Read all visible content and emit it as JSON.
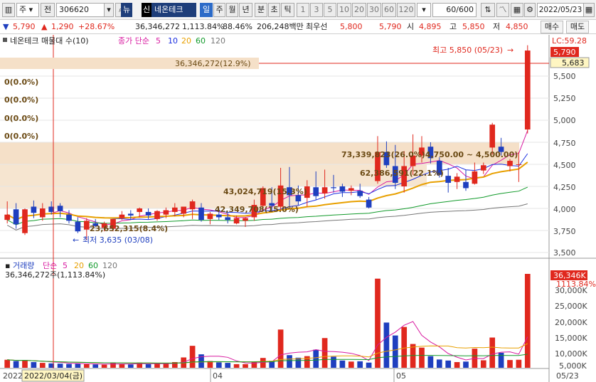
{
  "toolbar": {
    "btn1": "주",
    "btn2": "전",
    "code": "306620",
    "new_badge": "뉴",
    "credit_badge": "신",
    "name": "네온테크",
    "periods": [
      "일",
      "주",
      "월",
      "년",
      "분",
      "초",
      "틱"
    ],
    "period_active": "일",
    "minutes": [
      "1",
      "3",
      "5",
      "10",
      "20",
      "30",
      "60",
      "120"
    ],
    "count": "60/600",
    "date": "2022/05/23"
  },
  "info": {
    "price": "5,790",
    "change": "1,290",
    "change_pct": "+28.67%",
    "volume": "36,346,272",
    "volume_pct": "1,113.84%",
    "rate": "88.46%",
    "amount": "206,248백만",
    "priority_label": "최우선",
    "ask": "5,800",
    "bid": "5,790",
    "open_label": "시",
    "open": "4,895",
    "high_label": "고",
    "high": "5,850",
    "low_label": "저",
    "low": "4,850",
    "buy_label": "매수",
    "sell_label": "매도"
  },
  "price_panel": {
    "legend_name": "네온테크 매물대 수(10)",
    "ma_label": "종가 단순",
    "ma_periods": [
      "5",
      "10",
      "20",
      "60",
      "120"
    ],
    "lc_label": "LC:59.28",
    "current_price_tag": "5,790",
    "hover_price_tag": "5,683",
    "high_note": "최고 5,850 (05/23)",
    "low_note": "최저 3,635 (03/08)",
    "zero_labels": [
      "0(0.0%)",
      "0(0.0%)",
      "0(0.0%)",
      "0(0.0%)"
    ],
    "profile_labels": [
      "36,346,272(12.9%)",
      "73,339,823(26.0%)4,750.00 ~ 4,500.00)",
      "62,386,591(22.1%)",
      "43,024,719(15.3%)",
      "42,349,708(15.0%)",
      "23,652,315(8.4%)"
    ],
    "y_ticks": [
      "5,500",
      "5,250",
      "5,000",
      "4,750",
      "4,500",
      "4,250",
      "4,000",
      "3,750",
      "3,500"
    ]
  },
  "volume_panel": {
    "title": "거래량",
    "ma_label": "단순",
    "ma_periods": [
      "5",
      "20",
      "60",
      "120"
    ],
    "last_volume": "36,346,272주(1,113.84%)",
    "tag_volume": "36,346K",
    "tag_pct": "1113.84%",
    "y_ticks": [
      "30,000K",
      "25,000K",
      "20,000K",
      "15,000K",
      "10,000K",
      "5,000K"
    ]
  },
  "x_axis": {
    "labels": [
      "2022",
      "04",
      "05",
      "05/23"
    ],
    "crosshair_date": "2022/03/04(금)"
  },
  "colors": {
    "up": "#e0281e",
    "down": "#1f3fbf",
    "ma5": "#d81aa0",
    "ma10": "#1a2ee0",
    "ma20": "#e8a000",
    "ma60": "#119a2a",
    "ma120": "#777777",
    "profile": "#f5e0c8"
  },
  "chart_data": {
    "type": "candlestick",
    "price_range": [
      3450,
      5800
    ],
    "volume_range_k": [
      0,
      36346
    ],
    "candles": [
      {
        "o": 3870,
        "h": 4080,
        "l": 3830,
        "c": 3930,
        "v": 3100
      },
      {
        "o": 3990,
        "h": 4060,
        "l": 3770,
        "c": 3820,
        "v": 2600
      },
      {
        "o": 3720,
        "h": 4000,
        "l": 3700,
        "c": 3990,
        "v": 3000
      },
      {
        "o": 4020,
        "h": 4090,
        "l": 3890,
        "c": 3950,
        "v": 2200
      },
      {
        "o": 3900,
        "h": 4060,
        "l": 3860,
        "c": 4000,
        "v": 1900
      },
      {
        "o": 4020,
        "h": 4080,
        "l": 3930,
        "c": 3960,
        "v": 1700
      },
      {
        "o": 4030,
        "h": 4060,
        "l": 3900,
        "c": 3970,
        "v": 1600
      },
      {
        "o": 3930,
        "h": 3980,
        "l": 3830,
        "c": 3860,
        "v": 1500
      },
      {
        "o": 3850,
        "h": 3900,
        "l": 3720,
        "c": 3740,
        "v": 1600
      },
      {
        "o": 3760,
        "h": 3890,
        "l": 3640,
        "c": 3860,
        "v": 1400
      },
      {
        "o": 3830,
        "h": 3880,
        "l": 3790,
        "c": 3800,
        "v": 1300
      },
      {
        "o": 3780,
        "h": 3850,
        "l": 3740,
        "c": 3830,
        "v": 1200
      },
      {
        "o": 3770,
        "h": 3870,
        "l": 3740,
        "c": 3880,
        "v": 1900
      },
      {
        "o": 3890,
        "h": 3970,
        "l": 3870,
        "c": 3930,
        "v": 1500
      },
      {
        "o": 3940,
        "h": 3980,
        "l": 3870,
        "c": 3920,
        "v": 1300
      },
      {
        "o": 3960,
        "h": 4010,
        "l": 3900,
        "c": 4000,
        "v": 2000
      },
      {
        "o": 3960,
        "h": 4000,
        "l": 3880,
        "c": 3920,
        "v": 1400
      },
      {
        "o": 3880,
        "h": 3980,
        "l": 3860,
        "c": 3970,
        "v": 1600
      },
      {
        "o": 3930,
        "h": 4010,
        "l": 3890,
        "c": 3980,
        "v": 1500
      },
      {
        "o": 3960,
        "h": 4060,
        "l": 3910,
        "c": 4010,
        "v": 2200
      },
      {
        "o": 3940,
        "h": 4010,
        "l": 3900,
        "c": 4020,
        "v": 4000
      },
      {
        "o": 3990,
        "h": 4100,
        "l": 3880,
        "c": 4080,
        "v": 8500
      },
      {
        "o": 4010,
        "h": 4060,
        "l": 3850,
        "c": 3870,
        "v": 5200
      },
      {
        "o": 3880,
        "h": 3960,
        "l": 3820,
        "c": 3940,
        "v": 2600
      },
      {
        "o": 3930,
        "h": 4000,
        "l": 3870,
        "c": 3900,
        "v": 2100
      },
      {
        "o": 3900,
        "h": 3960,
        "l": 3830,
        "c": 3870,
        "v": 1900
      },
      {
        "o": 3830,
        "h": 3920,
        "l": 3820,
        "c": 3890,
        "v": 1400
      },
      {
        "o": 3860,
        "h": 3900,
        "l": 3790,
        "c": 3890,
        "v": 1400
      },
      {
        "o": 3900,
        "h": 4100,
        "l": 3860,
        "c": 4040,
        "v": 2200
      },
      {
        "o": 4030,
        "h": 4250,
        "l": 3970,
        "c": 4230,
        "v": 3800
      },
      {
        "o": 4060,
        "h": 4240,
        "l": 3980,
        "c": 4030,
        "v": 2700
      },
      {
        "o": 4020,
        "h": 4460,
        "l": 3980,
        "c": 4260,
        "v": 14800
      },
      {
        "o": 4240,
        "h": 4470,
        "l": 4020,
        "c": 4150,
        "v": 4900
      },
      {
        "o": 4150,
        "h": 4260,
        "l": 4040,
        "c": 4080,
        "v": 3900
      },
      {
        "o": 4120,
        "h": 4320,
        "l": 4020,
        "c": 4250,
        "v": 4500
      },
      {
        "o": 4240,
        "h": 4420,
        "l": 4100,
        "c": 4140,
        "v": 7000
      },
      {
        "o": 4170,
        "h": 4440,
        "l": 4110,
        "c": 4240,
        "v": 11500
      },
      {
        "o": 4240,
        "h": 4380,
        "l": 4180,
        "c": 4230,
        "v": 4300
      },
      {
        "o": 4250,
        "h": 4280,
        "l": 4130,
        "c": 4190,
        "v": 2800
      },
      {
        "o": 4200,
        "h": 4260,
        "l": 4150,
        "c": 4230,
        "v": 2400
      },
      {
        "o": 4200,
        "h": 4280,
        "l": 4120,
        "c": 4140,
        "v": 2500
      },
      {
        "o": 4100,
        "h": 4130,
        "l": 4000,
        "c": 4010,
        "v": 2000
      },
      {
        "o": 4310,
        "h": 4820,
        "l": 4280,
        "c": 4640,
        "v": 34500
      },
      {
        "o": 4640,
        "h": 4760,
        "l": 4460,
        "c": 4490,
        "v": 17500
      },
      {
        "o": 4480,
        "h": 4720,
        "l": 4220,
        "c": 4290,
        "v": 12500
      },
      {
        "o": 4250,
        "h": 4650,
        "l": 4180,
        "c": 4480,
        "v": 15800
      },
      {
        "o": 4480,
        "h": 4840,
        "l": 4380,
        "c": 4600,
        "v": 9200
      },
      {
        "o": 4600,
        "h": 4820,
        "l": 4520,
        "c": 4690,
        "v": 7800
      },
      {
        "o": 4700,
        "h": 4750,
        "l": 4510,
        "c": 4570,
        "v": 4500
      },
      {
        "o": 4540,
        "h": 4580,
        "l": 4350,
        "c": 4380,
        "v": 3200
      },
      {
        "o": 4370,
        "h": 4460,
        "l": 4180,
        "c": 4290,
        "v": 2800
      },
      {
        "o": 4300,
        "h": 4400,
        "l": 4220,
        "c": 4360,
        "v": 2200
      },
      {
        "o": 4300,
        "h": 4440,
        "l": 4200,
        "c": 4230,
        "v": 2400
      },
      {
        "o": 4280,
        "h": 4520,
        "l": 4270,
        "c": 4420,
        "v": 7400
      },
      {
        "o": 4430,
        "h": 4520,
        "l": 4390,
        "c": 4490,
        "v": 2900
      },
      {
        "o": 4690,
        "h": 4970,
        "l": 4610,
        "c": 4950,
        "v": 11700
      },
      {
        "o": 4700,
        "h": 4800,
        "l": 4600,
        "c": 4640,
        "v": 5800
      },
      {
        "o": 4480,
        "h": 4560,
        "l": 4420,
        "c": 4540,
        "v": 3000
      },
      {
        "o": 4500,
        "h": 4640,
        "l": 4300,
        "c": 4500,
        "v": 3100
      },
      {
        "o": 4895,
        "h": 5850,
        "l": 4850,
        "c": 5790,
        "v": 36346
      }
    ]
  }
}
